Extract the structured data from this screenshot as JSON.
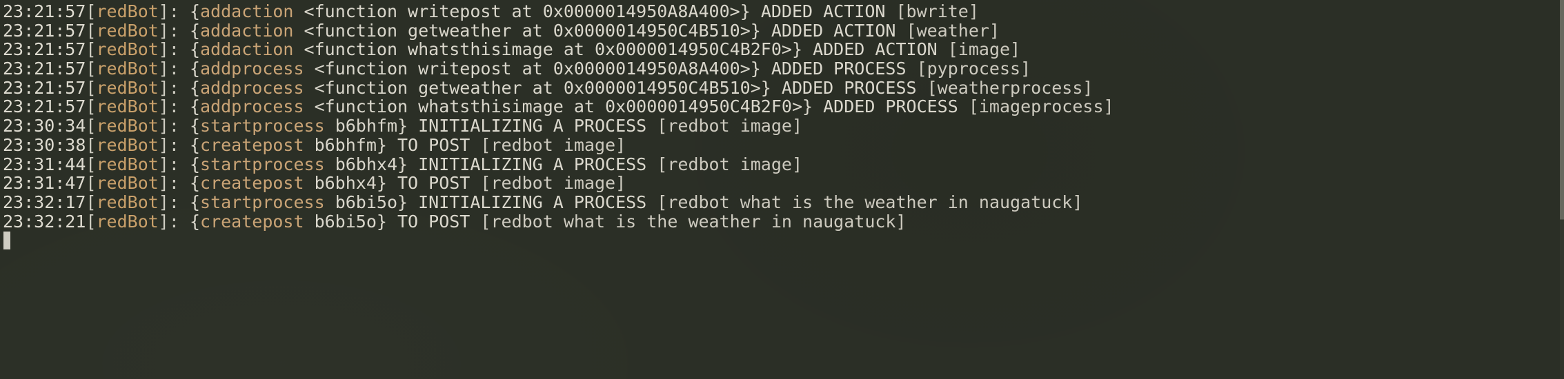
{
  "terminal": {
    "background_color": "#2b2f26",
    "foreground_color": "#d6d3c8",
    "accent_color": "#c9a06a",
    "cursor_color": "#cfcdc2",
    "bot_name": "redBot",
    "prompt_cursor": "",
    "lines": [
      {
        "time": "23:21:57",
        "bracket_open": "[",
        "name": "redBot",
        "bracket_close": "]: ",
        "brace_open": "{",
        "command": "addaction",
        "detail": " <function writepost at 0x0000014950A8A400>",
        "brace_close": "} ",
        "status": "ADDED ACTION ",
        "tag": "[bwrite]",
        "full": "23:21:57[redBot]: {addaction <function writepost at 0x0000014950A8A400>} ADDED ACTION [bwrite]"
      },
      {
        "time": "23:21:57",
        "bracket_open": "[",
        "name": "redBot",
        "bracket_close": "]: ",
        "brace_open": "{",
        "command": "addaction",
        "detail": " <function getweather at 0x0000014950C4B510>",
        "brace_close": "} ",
        "status": "ADDED ACTION ",
        "tag": "[weather]",
        "full": "23:21:57[redBot]: {addaction <function getweather at 0x0000014950C4B510>} ADDED ACTION [weather]"
      },
      {
        "time": "23:21:57",
        "bracket_open": "[",
        "name": "redBot",
        "bracket_close": "]: ",
        "brace_open": "{",
        "command": "addaction",
        "detail": " <function whatsthisimage at 0x0000014950C4B2F0>",
        "brace_close": "} ",
        "status": "ADDED ACTION ",
        "tag": "[image]",
        "full": "23:21:57[redBot]: {addaction <function whatsthisimage at 0x0000014950C4B2F0>} ADDED ACTION [image]"
      },
      {
        "time": "23:21:57",
        "bracket_open": "[",
        "name": "redBot",
        "bracket_close": "]: ",
        "brace_open": "{",
        "command": "addprocess",
        "detail": " <function writepost at 0x0000014950A8A400>",
        "brace_close": "} ",
        "status": "ADDED PROCESS ",
        "tag": "[pyprocess]",
        "full": "23:21:57[redBot]: {addprocess <function writepost at 0x0000014950A8A400>} ADDED PROCESS [pyprocess]"
      },
      {
        "time": "23:21:57",
        "bracket_open": "[",
        "name": "redBot",
        "bracket_close": "]: ",
        "brace_open": "{",
        "command": "addprocess",
        "detail": " <function getweather at 0x0000014950C4B510>",
        "brace_close": "} ",
        "status": "ADDED PROCESS ",
        "tag": "[weatherprocess]",
        "full": "23:21:57[redBot]: {addprocess <function getweather at 0x0000014950C4B510>} ADDED PROCESS [weatherprocess]"
      },
      {
        "time": "23:21:57",
        "bracket_open": "[",
        "name": "redBot",
        "bracket_close": "]: ",
        "brace_open": "{",
        "command": "addprocess",
        "detail": " <function whatsthisimage at 0x0000014950C4B2F0>",
        "brace_close": "} ",
        "status": "ADDED PROCESS ",
        "tag": "[imageprocess]",
        "full": "23:21:57[redBot]: {addprocess <function whatsthisimage at 0x0000014950C4B2F0>} ADDED PROCESS [imageprocess]"
      },
      {
        "time": "23:30:34",
        "bracket_open": "[",
        "name": "redBot",
        "bracket_close": "]: ",
        "brace_open": "{",
        "command": "startprocess",
        "detail": " b6bhfm",
        "brace_close": "} ",
        "status": "INITIALIZING A PROCESS ",
        "tag": "[redbot image]",
        "full": "23:30:34[redBot]: {startprocess b6bhfm} INITIALIZING A PROCESS [redbot image]"
      },
      {
        "time": "23:30:38",
        "bracket_open": "[",
        "name": "redBot",
        "bracket_close": "]: ",
        "brace_open": "{",
        "command": "createpost",
        "detail": " b6bhfm",
        "brace_close": "} ",
        "status": "TO POST ",
        "tag": "[redbot image]",
        "full": "23:30:38[redBot]: {createpost b6bhfm} TO POST [redbot image]"
      },
      {
        "time": "23:31:44",
        "bracket_open": "[",
        "name": "redBot",
        "bracket_close": "]: ",
        "brace_open": "{",
        "command": "startprocess",
        "detail": " b6bhx4",
        "brace_close": "} ",
        "status": "INITIALIZING A PROCESS ",
        "tag": "[redbot image]",
        "full": "23:31:44[redBot]: {startprocess b6bhx4} INITIALIZING A PROCESS [redbot image]"
      },
      {
        "time": "23:31:47",
        "bracket_open": "[",
        "name": "redBot",
        "bracket_close": "]: ",
        "brace_open": "{",
        "command": "createpost",
        "detail": " b6bhx4",
        "brace_close": "} ",
        "status": "TO POST ",
        "tag": "[redbot image]",
        "full": "23:31:47[redBot]: {createpost b6bhx4} TO POST [redbot image]"
      },
      {
        "time": "23:32:17",
        "bracket_open": "[",
        "name": "redBot",
        "bracket_close": "]: ",
        "brace_open": "{",
        "command": "startprocess",
        "detail": " b6bi5o",
        "brace_close": "} ",
        "status": "INITIALIZING A PROCESS ",
        "tag": "[redbot what is the weather in naugatuck]",
        "full": "23:32:17[redBot]: {startprocess b6bi5o} INITIALIZING A PROCESS [redbot what is the weather in naugatuck]"
      },
      {
        "time": "23:32:21",
        "bracket_open": "[",
        "name": "redBot",
        "bracket_close": "]: ",
        "brace_open": "{",
        "command": "createpost",
        "detail": " b6bi5o",
        "brace_close": "} ",
        "status": "TO POST ",
        "tag": "[redbot what is the weather in naugatuck]",
        "full": "23:32:21[redBot]: {createpost b6bi5o} TO POST [redbot what is the weather in naugatuck]"
      }
    ]
  }
}
